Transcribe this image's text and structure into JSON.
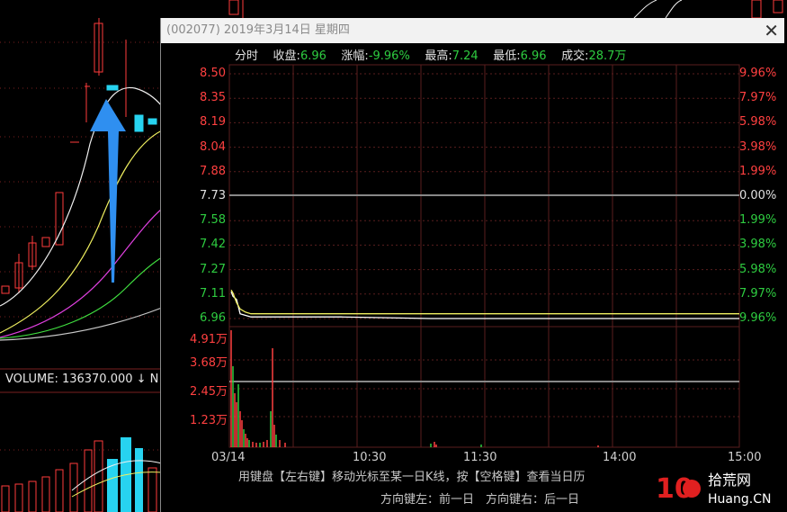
{
  "background": {
    "volume_label": "VOLUME: 136370.000 ↓ N",
    "colors": {
      "up": "#ff3b3b",
      "down": "#27d3f0",
      "ma5": "#f0f0f0",
      "ma10": "#f0f060",
      "ma20": "#e040e0",
      "ma30": "#40e040",
      "ma60": "#c8c8c8",
      "arrow": "#2f8ff0"
    }
  },
  "window": {
    "title": "(002077) 2019年3月14日 星期四",
    "close_icon": "close-icon"
  },
  "info_bar": {
    "label_mode": "分时",
    "close_label": "收盘:",
    "close_value": "6.96",
    "change_label": "涨幅:",
    "change_value": "-9.96%",
    "high_label": "最高:",
    "high_value": "7.24",
    "low_label": "最低:",
    "low_value": "6.96",
    "volume_label": "成交:",
    "volume_value": "28.7万"
  },
  "chart_data": {
    "type": "line",
    "title": "",
    "price_axis": [
      "8.50",
      "8.35",
      "8.19",
      "8.04",
      "7.88",
      "7.73",
      "7.58",
      "7.42",
      "7.27",
      "7.11",
      "6.96"
    ],
    "pct_axis": [
      "9.96%",
      "7.97%",
      "5.98%",
      "3.98%",
      "1.99%",
      "0.00%",
      "1.99%",
      "3.98%",
      "5.98%",
      "7.97%",
      "9.96%"
    ],
    "prev_close": 7.73,
    "ylim": [
      6.96,
      8.5
    ],
    "volume_axis": [
      "4.91万",
      "3.68万",
      "2.45万",
      "1.23万"
    ],
    "x_ticks": [
      "03/14",
      "10:30",
      "11:30",
      "14:00",
      "15:00"
    ],
    "series": [
      {
        "values": [
          7.13,
          7.1,
          7.08,
          6.99,
          6.98,
          6.97,
          6.97,
          6.97,
          6.96,
          6.96,
          6.96,
          6.96
        ]
      },
      {
        "values": [
          7.14,
          7.12,
          7.06,
          7.02,
          7.0,
          6.99,
          6.99,
          6.99,
          6.99,
          6.99,
          6.99,
          6.99
        ]
      }
    ],
    "volume_ticks_shown": true
  },
  "hints": {
    "line1": "用键盘【左右键】移动光标至某一日K线，按【空格键】查看当日历",
    "line2": "方向键左：前一日　方向键右：后一日"
  },
  "logo": {
    "text_top": "拾荒网",
    "text_bottom": "Huang.CN",
    "number": "10"
  }
}
